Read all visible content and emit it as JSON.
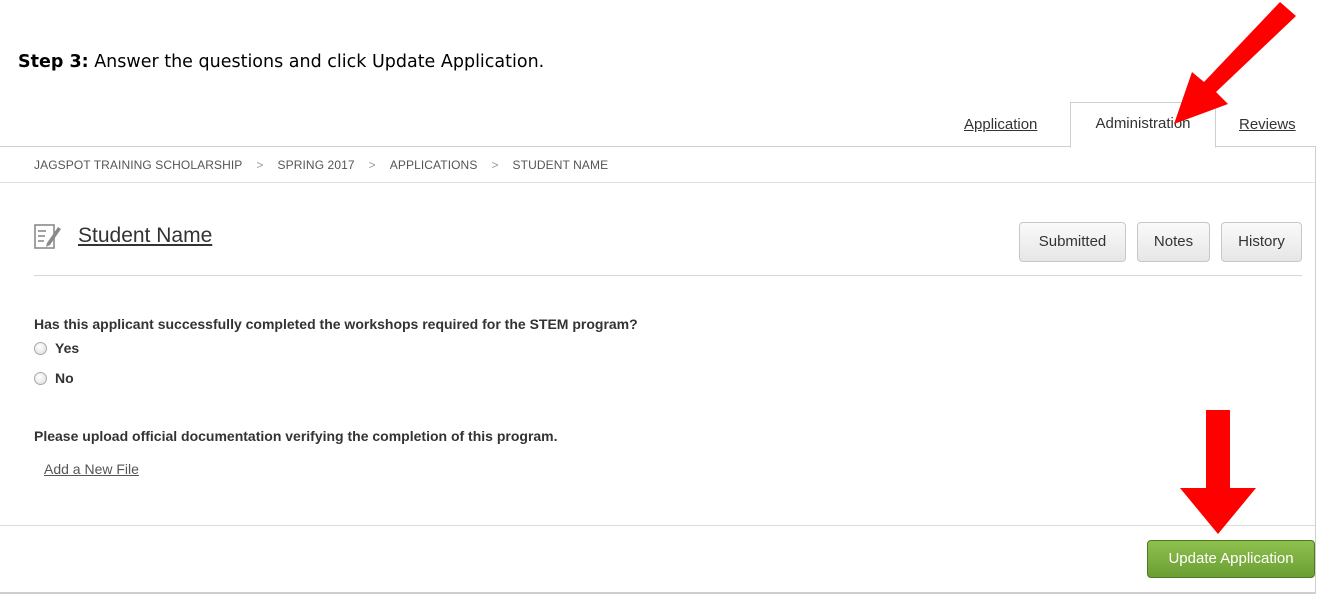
{
  "instruction": {
    "step": "Step 3:",
    "text": " Answer the questions and click Update Application."
  },
  "tabs": [
    {
      "label": "Application",
      "active": false
    },
    {
      "label": "Administration",
      "active": true
    },
    {
      "label": "Reviews",
      "active": false
    }
  ],
  "breadcrumb": [
    "JAGSPOT TRAINING SCHOLARSHIP",
    "SPRING 2017",
    "APPLICATIONS",
    "STUDENT NAME"
  ],
  "breadcrumb_separator": ">",
  "record": {
    "title": "Student Name",
    "icon": "edit-document-icon",
    "buttons": {
      "submitted": "Submitted",
      "notes": "Notes",
      "history": "History"
    }
  },
  "form": {
    "question": "Has this applicant successfully completed the workshops required for the STEM program?",
    "options": [
      "Yes",
      "No"
    ],
    "upload_label": "Please upload official documentation verifying the completion of this program.",
    "add_file": "Add a New File"
  },
  "footer": {
    "update_button": "Update Application"
  },
  "colors": {
    "accent_green": "#7aaf3f",
    "annotation_red": "#ff0000"
  }
}
